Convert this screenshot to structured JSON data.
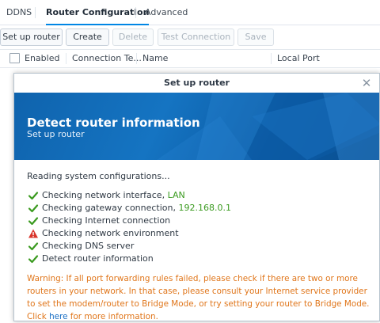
{
  "tabs": [
    {
      "label": "DDNS"
    },
    {
      "label": "Router Configuration"
    },
    {
      "label": "Advanced"
    }
  ],
  "toolbar": {
    "setup": "Set up router",
    "create": "Create",
    "delete": "Delete",
    "test": "Test Connection",
    "save": "Save"
  },
  "table": {
    "columns": [
      "Enabled",
      "Connection Te...",
      "Name",
      "Local Port"
    ]
  },
  "dialog": {
    "title": "Set up router",
    "banner_title": "Detect router information",
    "banner_subtitle": "Set up router",
    "reading": "Reading system configurations...",
    "checks": [
      {
        "text": "Checking network interface, ",
        "highlight": "LAN",
        "status": "ok"
      },
      {
        "text": "Checking gateway connection, ",
        "highlight": "192.168.0.1",
        "status": "ok"
      },
      {
        "text": "Checking Internet connection",
        "highlight": "",
        "status": "ok"
      },
      {
        "text": "Checking network environment",
        "highlight": "",
        "status": "warning"
      },
      {
        "text": "Checking DNS server",
        "highlight": "",
        "status": "ok"
      },
      {
        "text": "Detect router information",
        "highlight": "",
        "status": "ok"
      }
    ],
    "warning_text": "Warning: If all port forwarding rules failed, please check if there are two or more routers in your network. In that case, please consult your Internet service provider to set the modem/router to Bridge Mode, or try setting your router to Bridge Mode. Click ",
    "warning_link": "here",
    "warning_tail": " for more information."
  },
  "colors": {
    "accent": "#0086e5",
    "ok": "#3a9a1f",
    "warning_icon": "#d9342b",
    "warning_text": "#e0761b",
    "banner": "#1574c2"
  },
  "icons": {
    "ok": "check-icon",
    "warning": "warning-triangle-icon",
    "close": "close-icon"
  }
}
